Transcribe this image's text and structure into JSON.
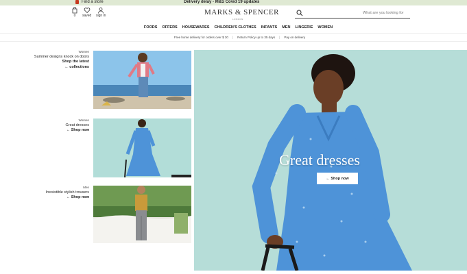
{
  "top_banner": {
    "find_store": "Find a store",
    "delivery_notice": "Delivery delay - M&S Covid 19 updates"
  },
  "header": {
    "bag_count": "0",
    "saved_label": "saved",
    "signin_label": "sign in",
    "logo": "MARKS & SPENCER",
    "logo_sub": "LONDON",
    "search_placeholder": "What are you looking for"
  },
  "nav": {
    "items": [
      "FOODS",
      "OFFERS",
      "HOUSEWARES",
      "CHILDREN'S CLOTHES",
      "INFANTS",
      "MEN",
      "LINGERIE",
      "WOMEN"
    ]
  },
  "promo": {
    "items": [
      "Free home delivery for orders over $ 30",
      "Return Policy up to 35 days",
      "Pay on delivery"
    ]
  },
  "features": [
    {
      "category": "Women",
      "title": "Summer designs knock on doors",
      "link": "Shop the latest",
      "link2": "collections"
    },
    {
      "category": "Women",
      "title": "Great dresses",
      "link": "Shop now"
    },
    {
      "category": "Men",
      "title": "Irresistible stylish trousers",
      "link": "Shop now"
    }
  ],
  "hero": {
    "title": "Great dresses",
    "button": "Shop now"
  },
  "colors": {
    "banner_bg": "#dfe9d3",
    "hero_bg": "#b6ddd8",
    "dress_blue": "#4e93d8"
  }
}
